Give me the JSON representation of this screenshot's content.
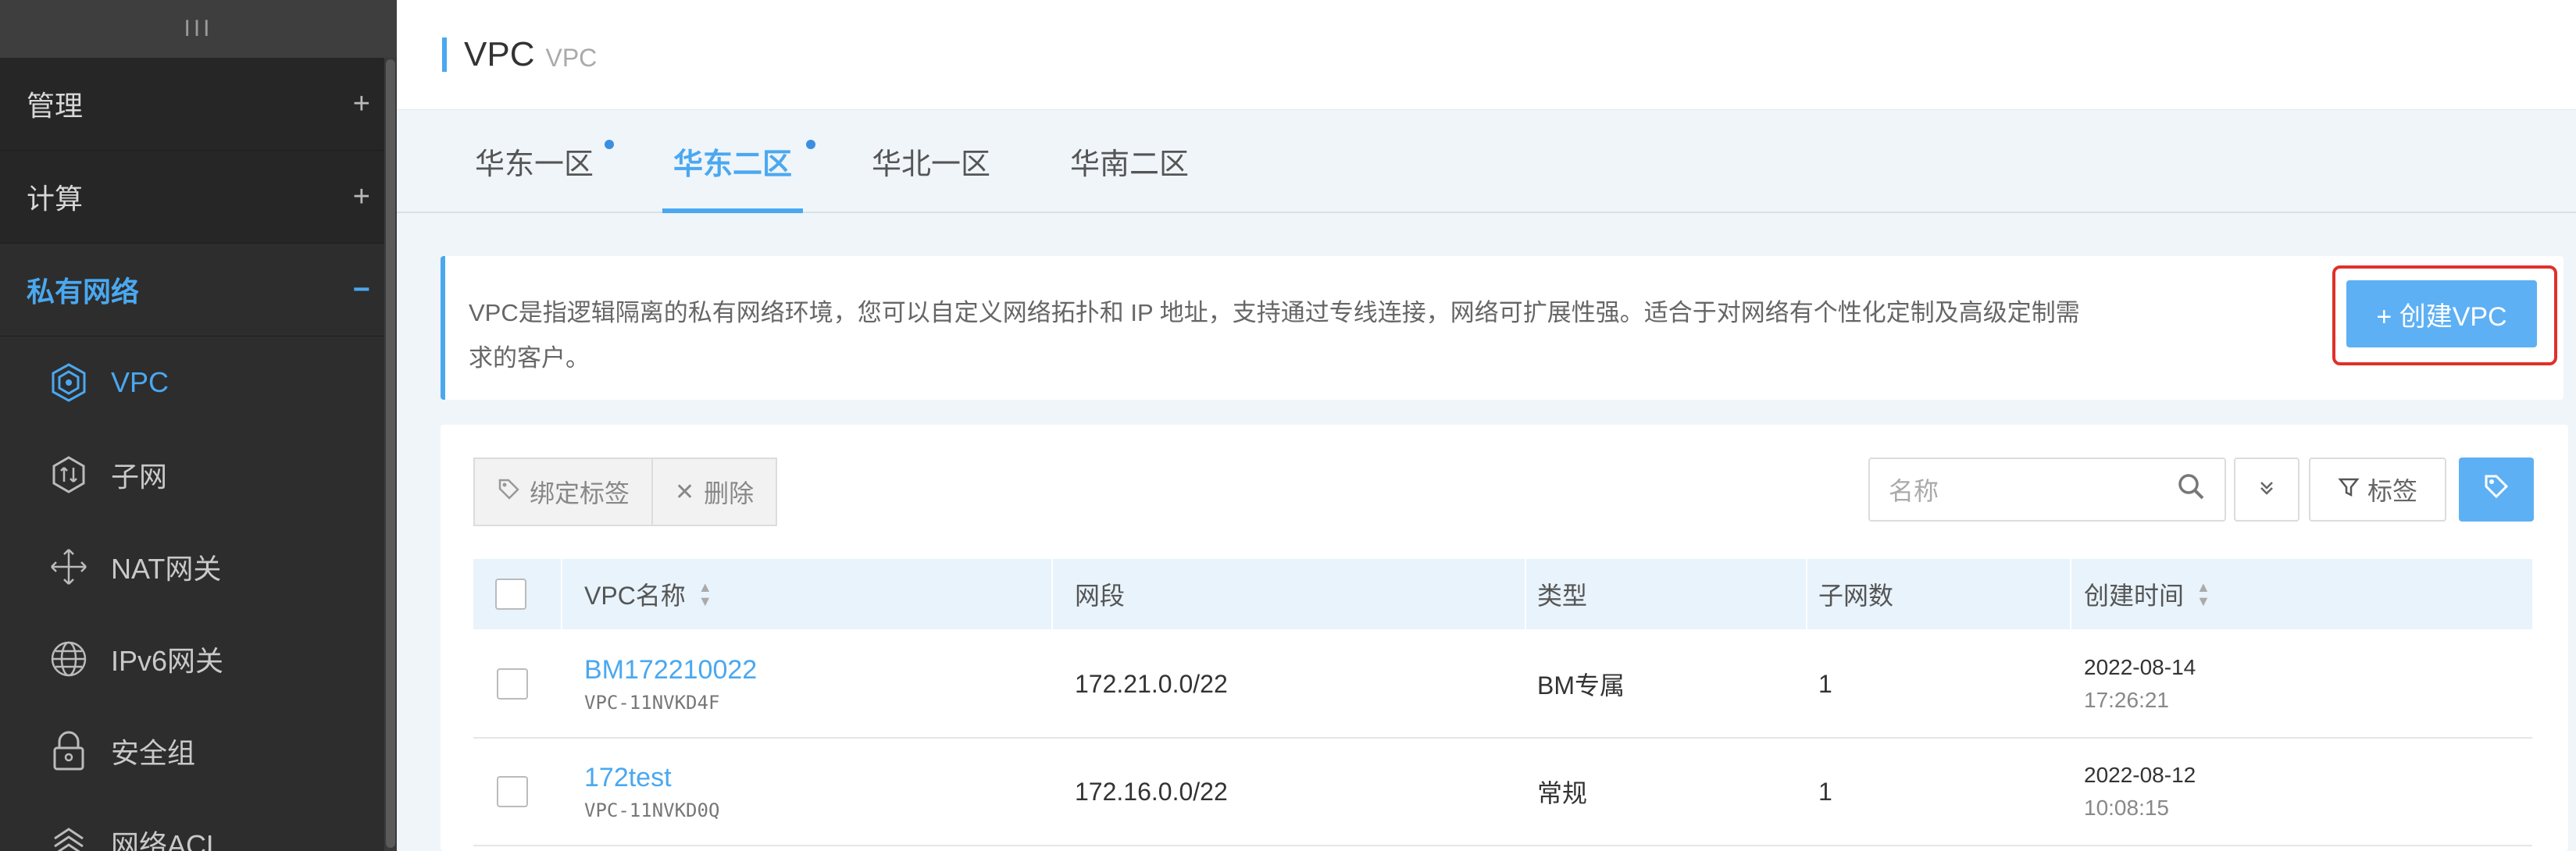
{
  "sidebar": {
    "top_glyph": "III",
    "sections": [
      {
        "label": "管理",
        "sign": "+"
      },
      {
        "label": "计算",
        "sign": "+"
      },
      {
        "label": "私有网络",
        "sign": "−"
      }
    ],
    "items": [
      {
        "label": "VPC",
        "icon": "vpc-hexagon-icon"
      },
      {
        "label": "子网",
        "icon": "subnet-icon"
      },
      {
        "label": "NAT网关",
        "icon": "nat-gateway-icon"
      },
      {
        "label": "IPv6网关",
        "icon": "ipv6-globe-icon"
      },
      {
        "label": "安全组",
        "icon": "lock-icon"
      },
      {
        "label": "网络ACL",
        "icon": "acl-icon"
      }
    ]
  },
  "header": {
    "title": "VPC",
    "subtitle": "VPC"
  },
  "tabs": [
    {
      "label": "华东一区",
      "dot": true
    },
    {
      "label": "华东二区",
      "dot": true
    },
    {
      "label": "华北一区",
      "dot": false
    },
    {
      "label": "华南二区",
      "dot": false
    }
  ],
  "info": {
    "line1": "VPC是指逻辑隔离的私有网络环境，您可以自定义网络拓扑和 IP 地址，支持通过专线连接，网络可扩展性强。适合于对网络有个性化定制及高级定制需",
    "line2": "求的客户。",
    "create_button": "+ 创建VPC"
  },
  "toolbar": {
    "bind_tag": "绑定标签",
    "delete": "删除",
    "search_placeholder": "名称",
    "expand_glyph": "»",
    "tag_filter": "标签"
  },
  "table": {
    "columns": [
      "VPC名称",
      "网段",
      "类型",
      "子网数",
      "创建时间"
    ],
    "rows": [
      {
        "name": "BM172210022",
        "id": "VPC-11NVKD4F",
        "cidr": "172.21.0.0/22",
        "type": "BM专属",
        "subnets": "1",
        "date": "2022-08-14",
        "time": "17:26:21"
      },
      {
        "name": "172test",
        "id": "VPC-11NVKD0Q",
        "cidr": "172.16.0.0/22",
        "type": "常规",
        "subnets": "1",
        "date": "2022-08-12",
        "time": "10:08:15"
      }
    ]
  },
  "colors": {
    "accent": "#4aa8f0",
    "sidebar_bg": "#2d2d2d",
    "highlight_border": "#e0302a"
  }
}
